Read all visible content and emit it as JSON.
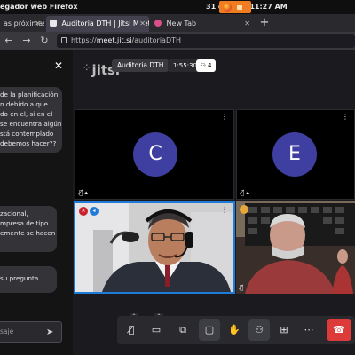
{
  "os_bar": {
    "app_title": "egador web Firefox",
    "datetime": "31 de may  11:27 AM"
  },
  "tabs": [
    {
      "label": "as próximas",
      "active": false
    },
    {
      "label": "Auditoria DTH | Jitsi Meet",
      "active": true
    },
    {
      "label": "New Tab",
      "active": false
    }
  ],
  "url_bar": {
    "prefix": "https://",
    "host": "meet.jit.si",
    "path": "/auditoriaDTH"
  },
  "chat": {
    "messages": [
      {
        "lines": [
          "de la planificación",
          "n debido a que",
          "do en el, si en el",
          "se encuentra algún",
          "stá contemplado",
          "debemos hacer??"
        ]
      },
      {
        "lines": [
          "zacional,",
          "mpresa de tipo",
          "emente se hacen"
        ]
      },
      {
        "lines": [
          "su pregunta"
        ]
      }
    ],
    "input_placeholder": "saje"
  },
  "conference": {
    "logo_text": "jitsi",
    "subject": "Auditoria DTH",
    "timer": "1:55:30",
    "participant_count": "4",
    "tiles": [
      {
        "initial": "C"
      },
      {
        "initial": "E"
      }
    ]
  },
  "colors": {
    "avatar": "#3e3fa1",
    "active_speaker_border": "#1f7ad8",
    "hangup": "#dd3a3a"
  }
}
